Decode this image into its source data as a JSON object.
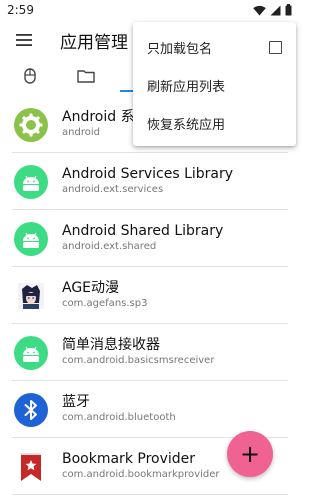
{
  "status_bar": {
    "time": "2:59"
  },
  "header": {
    "title": "应用管理"
  },
  "tabs": [
    {
      "icon": "mouse-icon"
    },
    {
      "icon": "folder-icon"
    }
  ],
  "menu": {
    "items": [
      {
        "label": "只加载包名",
        "has_checkbox": true,
        "checked": false
      },
      {
        "label": "刷新应用列表"
      },
      {
        "label": "恢复系统应用"
      }
    ]
  },
  "apps": [
    {
      "name": "Android 系",
      "package": "android",
      "icon": "android-settings-icon"
    },
    {
      "name": "Android Services Library",
      "package": "android.ext.services",
      "icon": "android-robot-icon"
    },
    {
      "name": "Android Shared Library",
      "package": "android.ext.shared",
      "icon": "android-robot-icon"
    },
    {
      "name": "AGE动漫",
      "package": "com.agefans.sp3",
      "icon": "age-anime-icon"
    },
    {
      "name": "简单消息接收器",
      "package": "com.android.basicsmsreceiver",
      "icon": "android-robot-icon"
    },
    {
      "name": "蓝牙",
      "package": "com.android.bluetooth",
      "icon": "bluetooth-icon"
    },
    {
      "name": "Bookmark Provider",
      "package": "com.android.bookmarkprovider",
      "icon": "bookmark-icon"
    }
  ],
  "fab": {
    "label": "+"
  },
  "colors": {
    "accent": "#1e88e5",
    "fab": "#f06292",
    "android_green": "#3ddc84",
    "settings_green": "#8bc34a",
    "bluetooth_blue": "#1e63d6",
    "bookmark_red": "#c62828"
  }
}
